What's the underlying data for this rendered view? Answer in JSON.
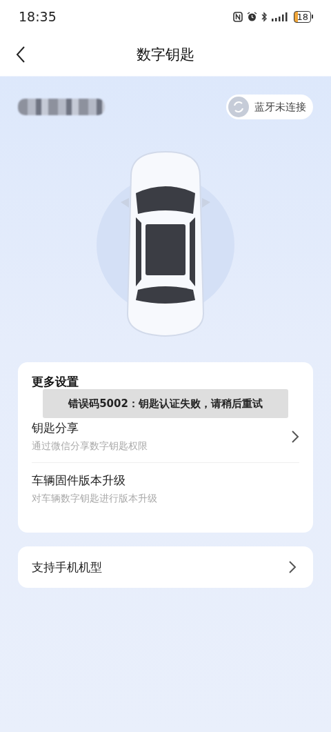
{
  "status_bar": {
    "time": "18:35",
    "battery": "18"
  },
  "header": {
    "title": "数字钥匙"
  },
  "vehicle": {
    "bluetooth": {
      "label": "蓝牙未连接",
      "connected": false
    }
  },
  "settings": {
    "title": "更多设置",
    "items": [
      {
        "title": "钥匙分享",
        "subtitle": "通过微信分享数字钥匙权限",
        "chevron": true
      },
      {
        "title": "车辆固件版本升级",
        "subtitle": "对车辆数字钥匙进行版本升级",
        "chevron": false
      }
    ]
  },
  "links": [
    {
      "title": "支持手机机型",
      "chevron": true
    }
  ],
  "toast": {
    "message": "错误码5002：钥匙认证失败，请稍后重试"
  }
}
